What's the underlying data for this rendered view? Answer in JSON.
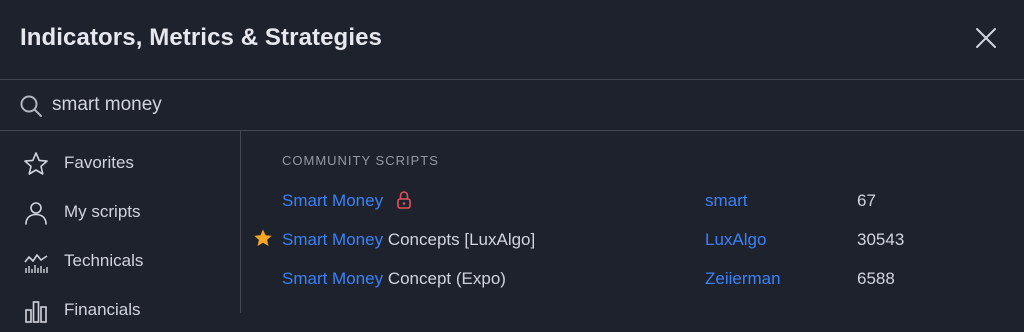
{
  "header": {
    "title": "Indicators, Metrics & Strategies"
  },
  "search": {
    "value": "smart money"
  },
  "sidebar": {
    "items": [
      {
        "label": "Favorites",
        "icon": "star-icon"
      },
      {
        "label": "My scripts",
        "icon": "user-icon"
      },
      {
        "label": "Technicals",
        "icon": "chart-icon"
      },
      {
        "label": "Financials",
        "icon": "bar-chart-icon"
      }
    ]
  },
  "main": {
    "section_title": "COMMUNITY SCRIPTS",
    "rows": [
      {
        "name_highlight": "Smart Money",
        "name_rest": "",
        "author": "smart",
        "count": "67",
        "locked": true,
        "favorite": false
      },
      {
        "name_highlight": "Smart Money",
        "name_rest": " Concepts [LuxAlgo]",
        "author": "LuxAlgo",
        "count": "30543",
        "locked": false,
        "favorite": true
      },
      {
        "name_highlight": "Smart Money",
        "name_rest": " Concept (Expo)",
        "author": "Zeiierman",
        "count": "6588",
        "locked": false,
        "favorite": false
      }
    ]
  },
  "colors": {
    "background": "#1e222d",
    "accent": "#3b82f6",
    "lock": "#e0525c",
    "star": "#f5a623",
    "divider": "#434651"
  }
}
